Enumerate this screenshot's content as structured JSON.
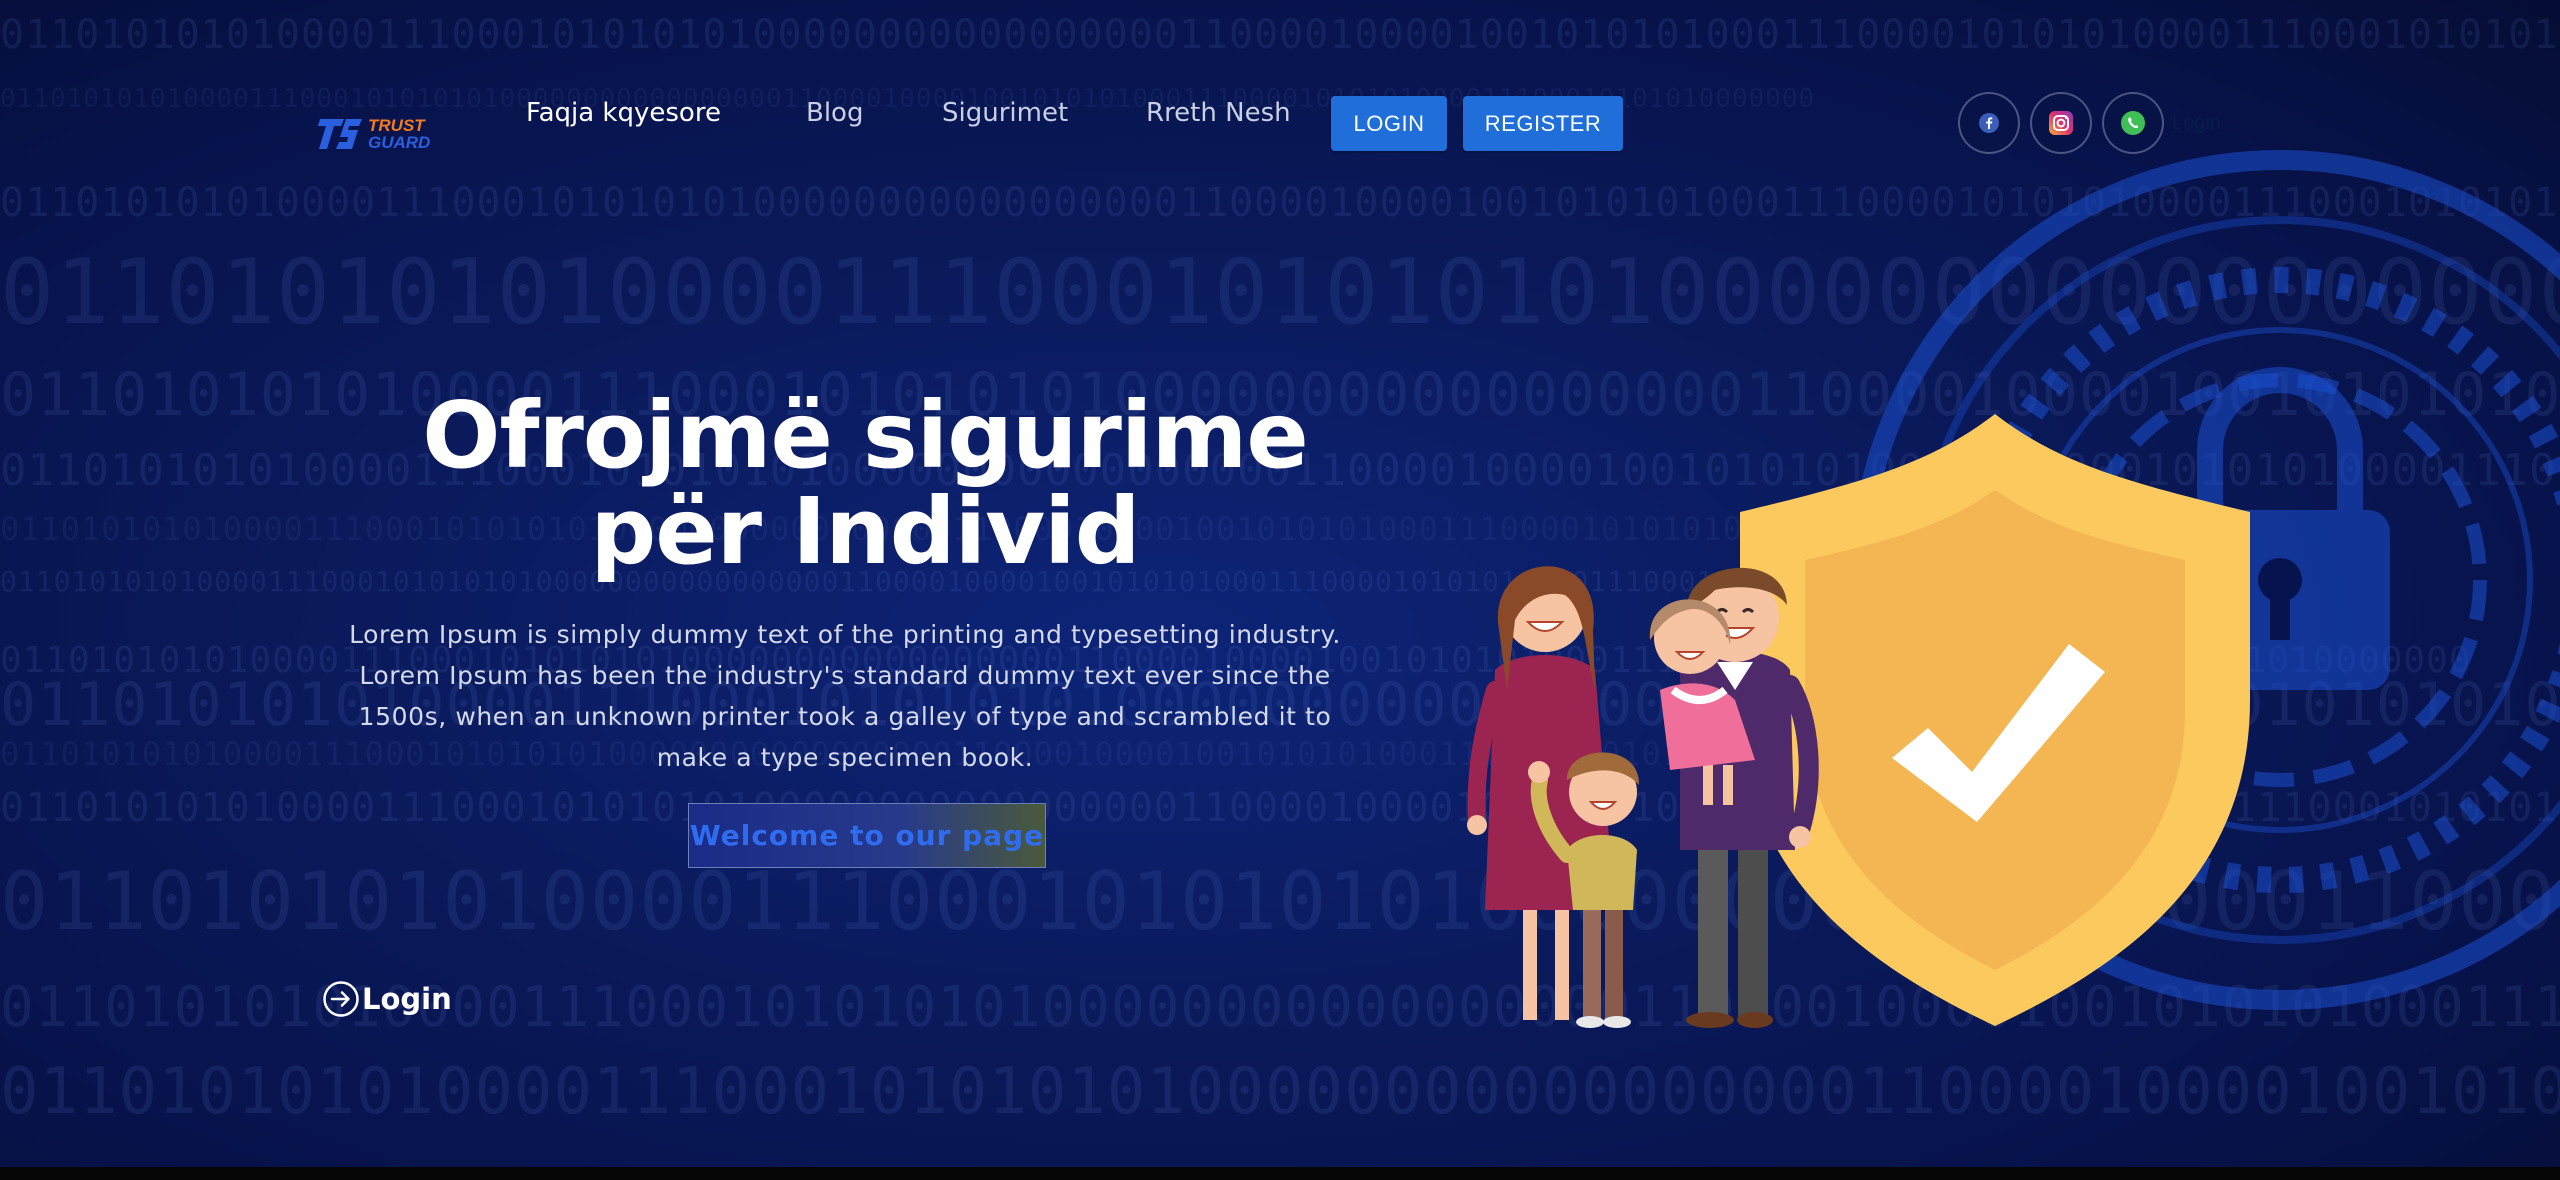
{
  "brand": {
    "logo_line1": "TRUST",
    "logo_line2": "GUARD"
  },
  "nav": {
    "links": [
      "Faqja kqyesore",
      "Blog",
      "Sigurimet",
      "Rreth Nesh"
    ],
    "login_button": "LOGIN",
    "register_button": "REGISTER"
  },
  "social": {
    "icons": [
      "facebook-icon",
      "instagram-icon",
      "whatsapp-icon"
    ],
    "ghost_login": "Login"
  },
  "hero": {
    "title": "Ofrojmë sigurime për Individ",
    "description": "Lorem Ipsum is simply dummy text of the printing and typesetting industry. Lorem Ipsum has been the industry's standard dummy text ever since the 1500s, when an unknown printer took a galley of type and scrambled it to make a type specimen book.",
    "cta": "Welcome to our page",
    "login_link": "Login"
  },
  "background": {
    "binary_pattern": "0110101010100001110001010101010000000000000000011000010000100101010100011100001010101000011100010101010000000"
  },
  "colors": {
    "background": "#0a1a5c",
    "accent_blue": "#1f6ed9",
    "logo_orange": "#f47a1f",
    "logo_blue": "#2a5fe0",
    "shield_yellow": "#fbc95d"
  }
}
